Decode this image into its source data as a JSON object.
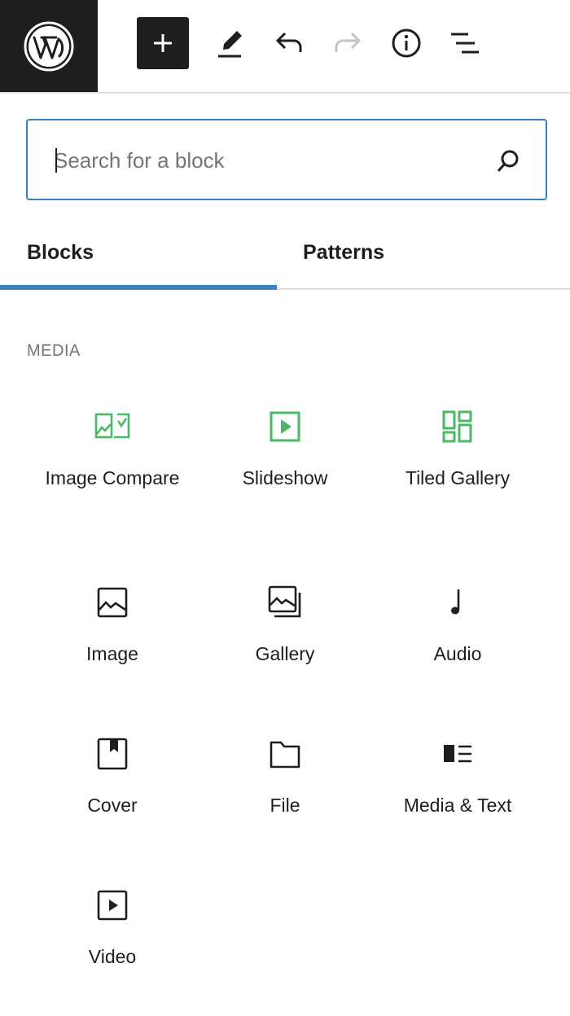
{
  "toolbar": {
    "logo_icon": "wordpress-logo-icon",
    "add_icon": "plus-icon",
    "edit_icon": "pencil-icon",
    "undo_icon": "undo-icon",
    "redo_icon": "redo-icon",
    "info_icon": "info-icon",
    "outline_icon": "list-view-icon"
  },
  "search": {
    "placeholder": "Search for a block",
    "value": "",
    "icon": "search-icon"
  },
  "tabs": [
    {
      "label": "Blocks",
      "active": true
    },
    {
      "label": "Patterns",
      "active": false
    }
  ],
  "section": {
    "title": "MEDIA"
  },
  "blocks": [
    {
      "label": "Image Compare",
      "icon": "image-compare-icon",
      "color": "#4ab866"
    },
    {
      "label": "Slideshow",
      "icon": "slideshow-icon",
      "color": "#4ab866"
    },
    {
      "label": "Tiled Gallery",
      "icon": "tiled-gallery-icon",
      "color": "#4ab866"
    },
    {
      "label": "Image",
      "icon": "image-icon",
      "color": "#1e1e1e"
    },
    {
      "label": "Gallery",
      "icon": "gallery-icon",
      "color": "#1e1e1e"
    },
    {
      "label": "Audio",
      "icon": "audio-icon",
      "color": "#1e1e1e"
    },
    {
      "label": "Cover",
      "icon": "cover-icon",
      "color": "#1e1e1e"
    },
    {
      "label": "File",
      "icon": "file-icon",
      "color": "#1e1e1e"
    },
    {
      "label": "Media & Text",
      "icon": "media-text-icon",
      "color": "#1e1e1e"
    },
    {
      "label": "Video",
      "icon": "video-icon",
      "color": "#1e1e1e"
    }
  ],
  "colors": {
    "accent": "#3582c4",
    "dark": "#1e1e1e",
    "muted": "#757575",
    "jetpack_green": "#4ab866"
  }
}
